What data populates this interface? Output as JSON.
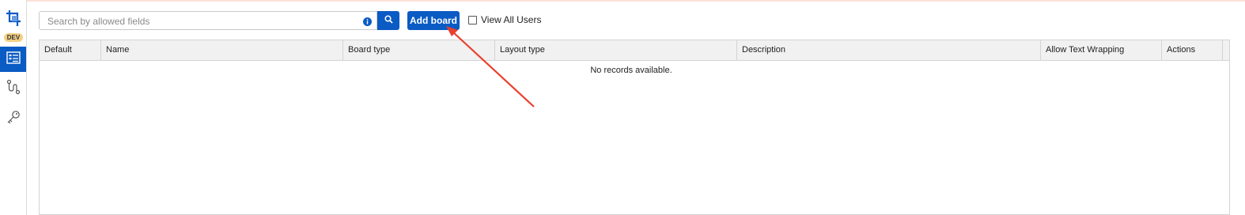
{
  "sidebar": {
    "badge": "DEV",
    "icons": [
      "crop-logo-icon",
      "boards-list-icon",
      "workflow-icon",
      "key-icon"
    ]
  },
  "toolbar": {
    "search_placeholder": "Search by allowed fields",
    "search_value": "",
    "add_board_label": "Add board",
    "view_all_label": "View All Users",
    "view_all_checked": false
  },
  "grid": {
    "columns": [
      "Default",
      "Name",
      "Board type",
      "Layout type",
      "Description",
      "Allow Text Wrapping",
      "Actions"
    ],
    "rows": [],
    "empty_message": "No records available."
  },
  "colors": {
    "accent": "#0a5bc4",
    "badge": "#f3cf85",
    "annotation_arrow": "#e8402e"
  }
}
